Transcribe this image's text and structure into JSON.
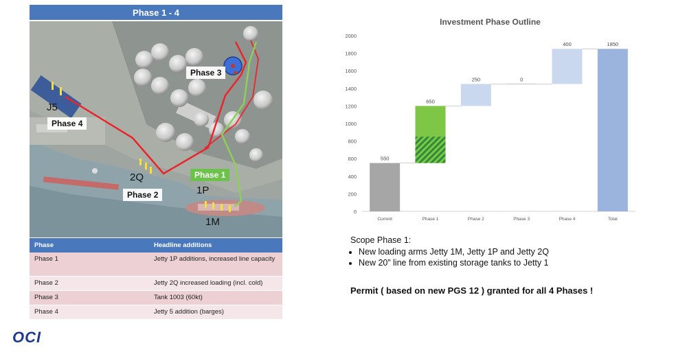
{
  "header": {
    "title": "Phase 1 - 4"
  },
  "map_labels": {
    "phase3": "Phase 3",
    "phase4": "Phase 4",
    "phase1": "Phase 1",
    "phase2": "Phase 2",
    "j5": "J5",
    "q2": "2Q",
    "p1": "1P",
    "m1": "1M"
  },
  "table": {
    "headers": [
      "Phase",
      "Headline additions"
    ],
    "rows": [
      [
        "Phase 1",
        "Jetty 1P additions, increased line capacity"
      ],
      [
        "Phase 2",
        "Jetty 2Q increased loading (incl. cold)"
      ],
      [
        "Phase 3",
        "Tank 1003 (60kt)"
      ],
      [
        "Phase 4",
        "Jetty 5 addition (barges)"
      ]
    ]
  },
  "logo": "OCI",
  "colors": {
    "banner": "#4a78bd",
    "route_red": "#e8262b",
    "route_green": "#8ccf5c",
    "current_bar": "#a6a6a6",
    "phase1_bar": "#7ec646",
    "phase_light_blue": "#c9d8ef",
    "total_bar": "#9bb4de"
  },
  "chart_data": {
    "type": "waterfall",
    "title": "Investment Phase Outline",
    "categories": [
      "Current",
      "Phase 1",
      "Phase 2",
      "Phase 3",
      "Phase 4",
      "Total"
    ],
    "values": [
      550,
      650,
      250,
      0,
      400,
      1850
    ],
    "labels": [
      "550",
      "650",
      "250",
      "0",
      "400",
      "1850"
    ],
    "phase1_hatched_portion": 300,
    "ylim": [
      0,
      2000
    ],
    "yticks": [
      0,
      200,
      400,
      600,
      800,
      1000,
      1200,
      1400,
      1600,
      1800,
      2000
    ],
    "grid": false,
    "legend": "none"
  },
  "scope": {
    "heading": "Scope Phase 1:",
    "bullets": [
      "New loading arms Jetty 1M, Jetty 1P and Jetty 2Q",
      "New 20” line from existing storage tanks to Jetty 1"
    ]
  },
  "permit": "Permit ( based on new PGS 12 ) granted for all 4 Phases !"
}
